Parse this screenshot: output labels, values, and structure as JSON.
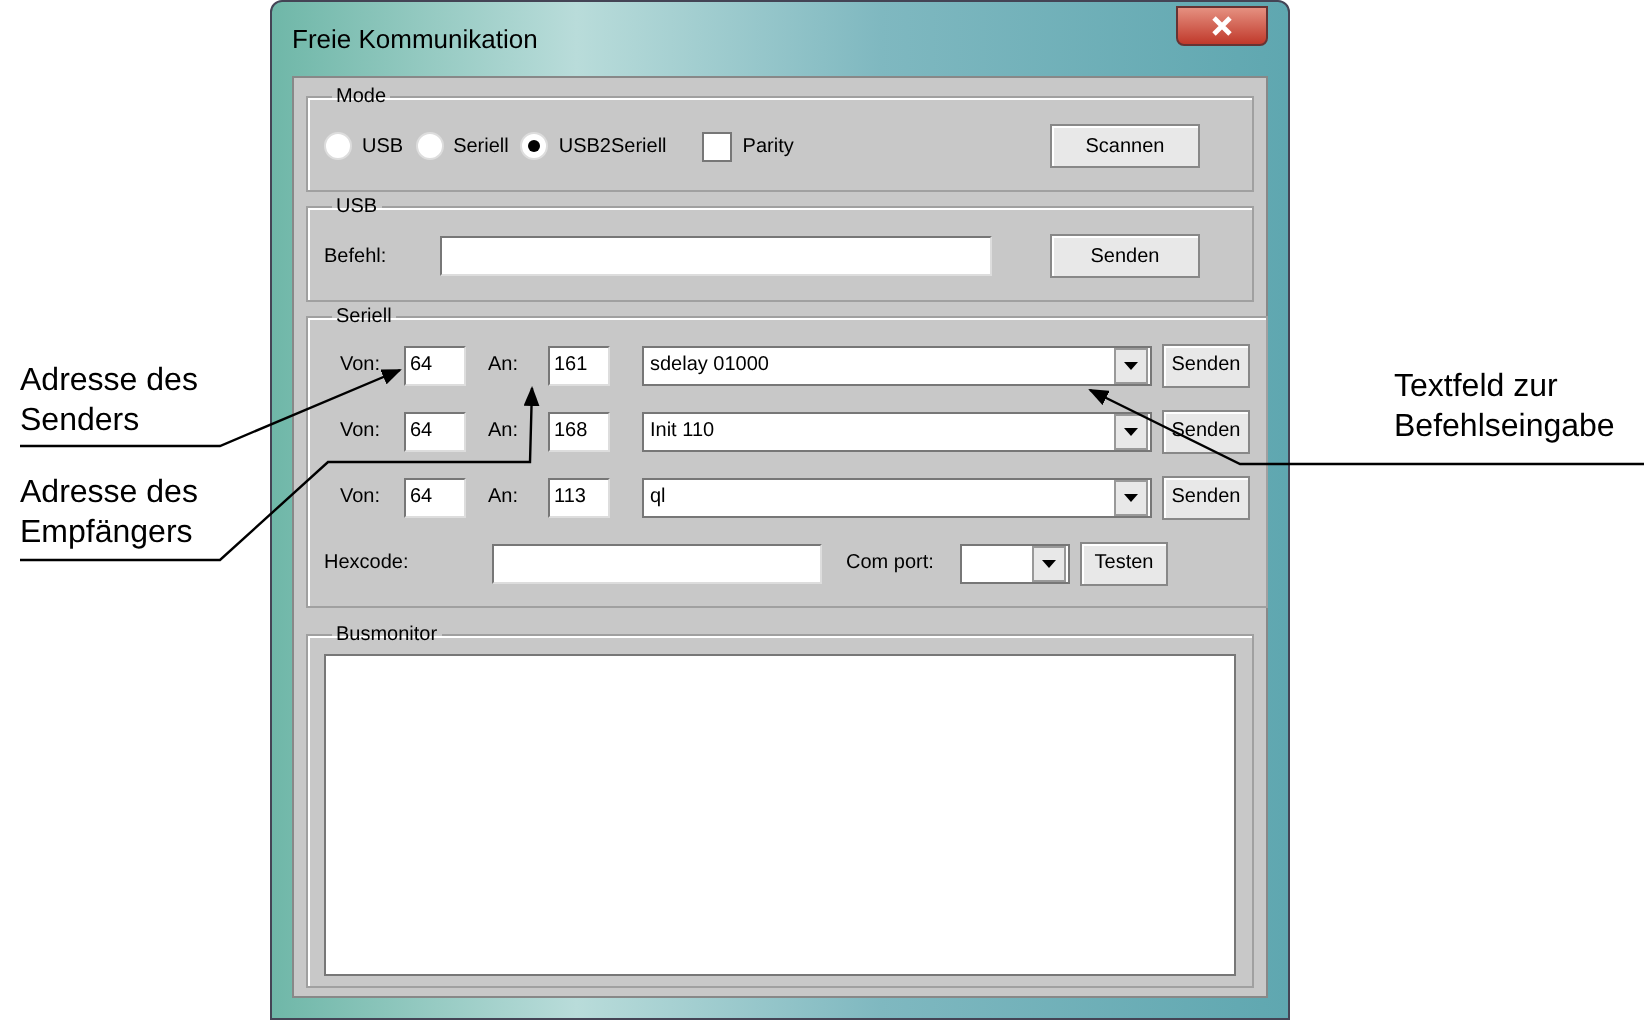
{
  "window": {
    "title": "Freie Kommunikation"
  },
  "mode": {
    "label": "Mode",
    "options": [
      {
        "label": "USB",
        "selected": false
      },
      {
        "label": "Seriell",
        "selected": false
      },
      {
        "label": "USB2Seriell",
        "selected": true
      }
    ],
    "parity": {
      "label": "Parity",
      "checked": false
    },
    "scan_button": "Scannen"
  },
  "usb": {
    "label": "USB",
    "command_label": "Befehl:",
    "send_button": "Senden"
  },
  "serial": {
    "label": "Seriell",
    "rows": [
      {
        "from_label": "Von:",
        "from": "64",
        "to_label": "An:",
        "to": "161",
        "command": "sdelay 01000",
        "send_button": "Senden"
      },
      {
        "from_label": "Von:",
        "from": "64",
        "to_label": "An:",
        "to": "168",
        "command": "Init 110",
        "send_button": "Senden"
      },
      {
        "from_label": "Von:",
        "from": "64",
        "to_label": "An:",
        "to": "113",
        "command": "ql",
        "send_button": "Senden"
      }
    ],
    "hexcode_label": "Hexcode:",
    "comport_label": "Com port:",
    "test_button": "Testen"
  },
  "busmonitor": {
    "label": "Busmonitor"
  },
  "annotations": [
    {
      "lines": [
        "Adresse des",
        "Senders"
      ]
    },
    {
      "lines": [
        "Adresse des",
        "Empfängers"
      ]
    },
    {
      "lines": [
        "Textfeld zur",
        "Befehlseingabe"
      ]
    }
  ]
}
